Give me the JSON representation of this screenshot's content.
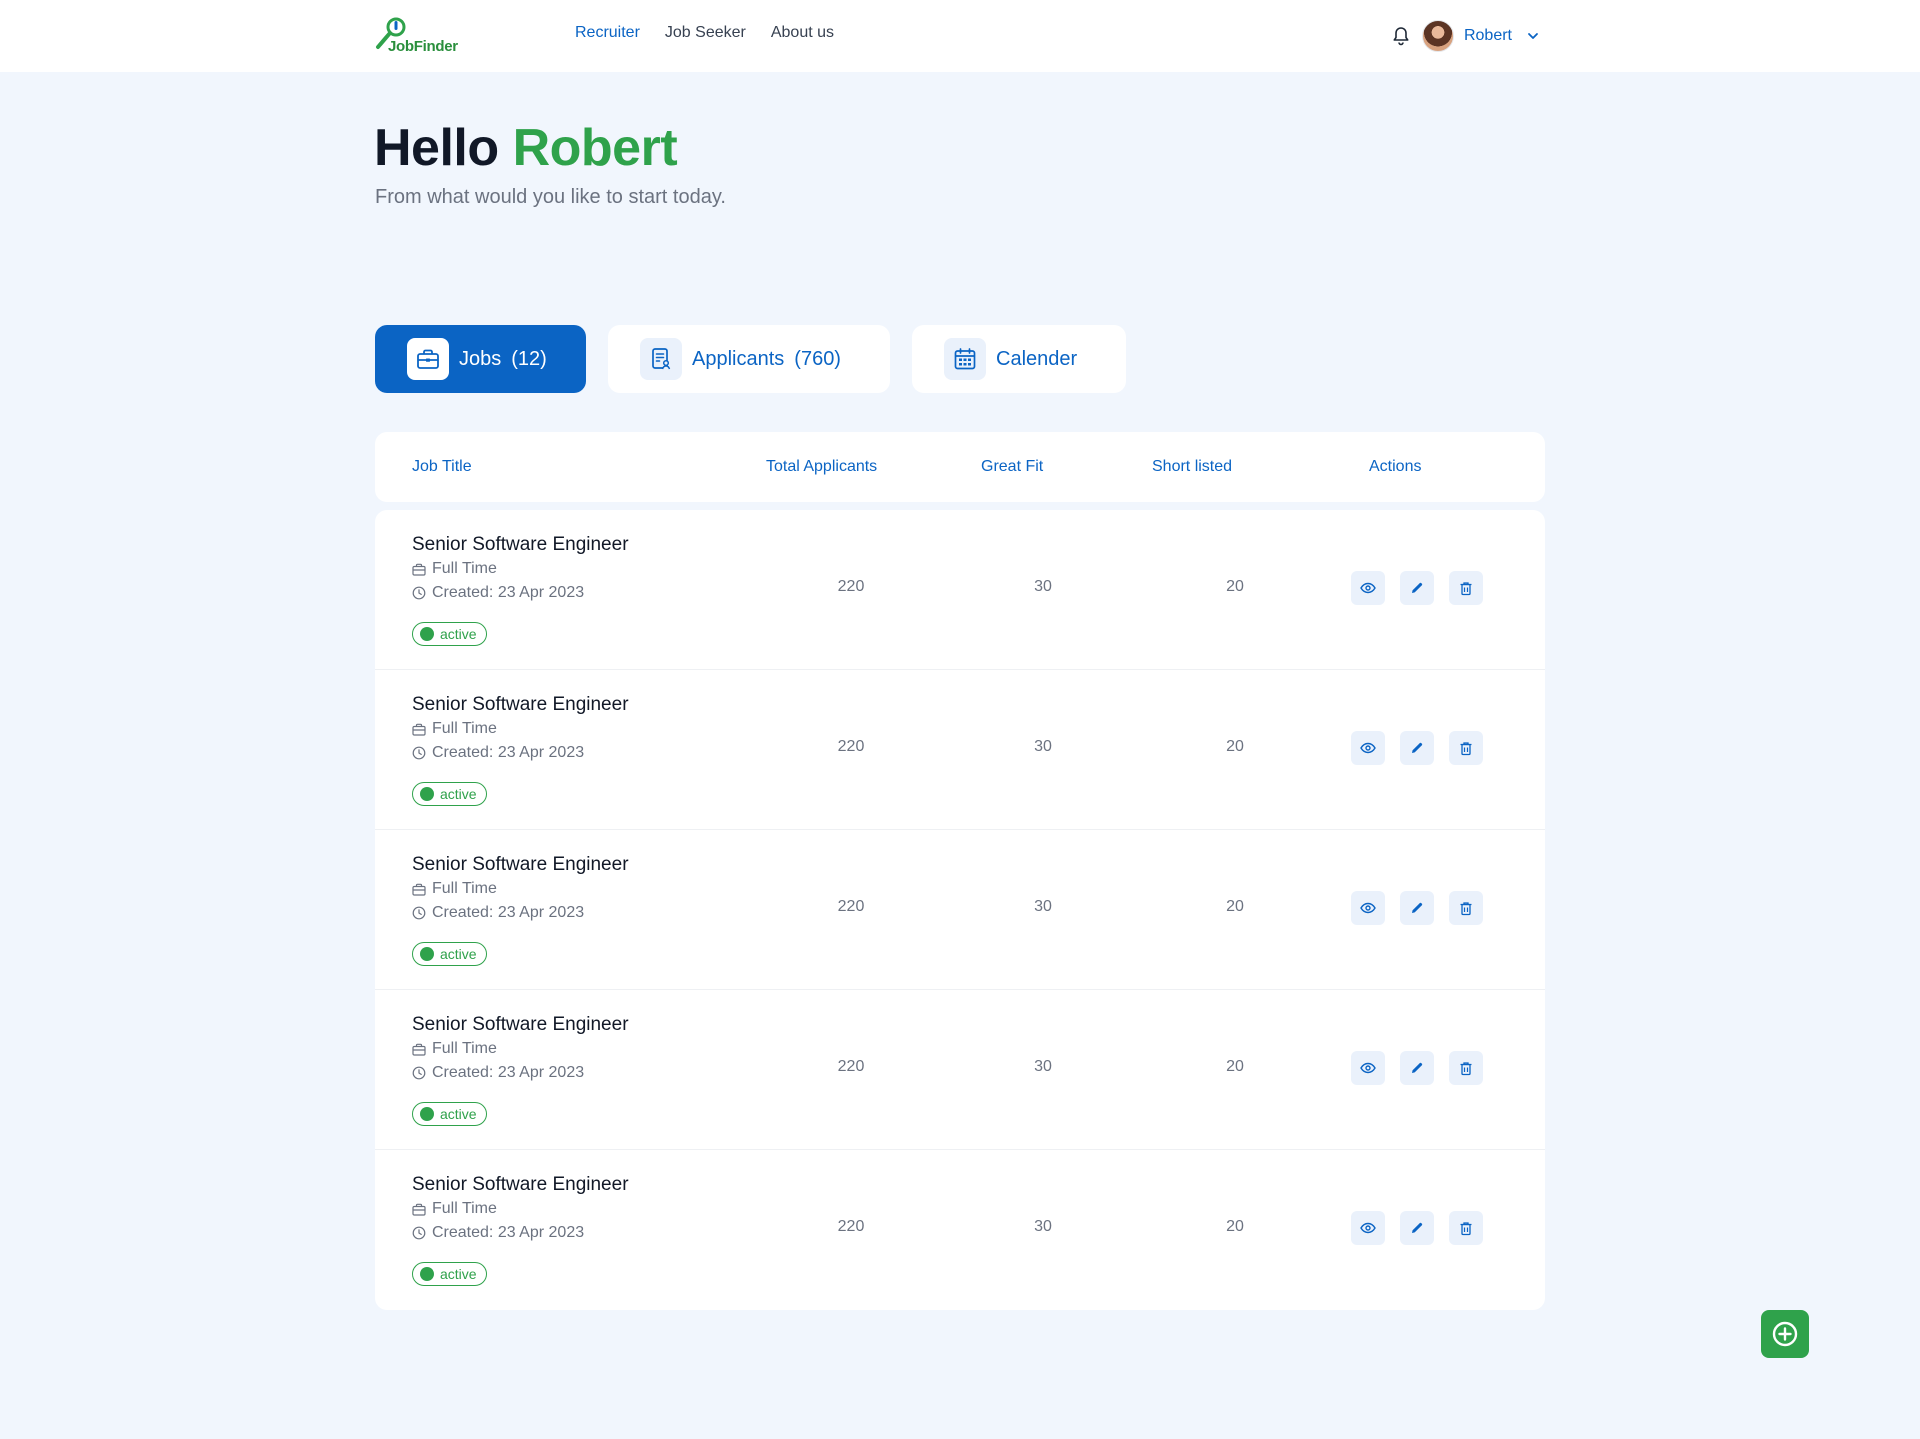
{
  "header": {
    "logo_text": "JobFinder",
    "nav": [
      {
        "label": "Recruiter",
        "active": true
      },
      {
        "label": "Job Seeker",
        "active": false
      },
      {
        "label": "About us",
        "active": false
      }
    ],
    "user_name": "Robert"
  },
  "greeting": {
    "hello": "Hello",
    "name": "Robert",
    "subtitle": "From what would you like to start today."
  },
  "tabs": [
    {
      "label": "Jobs",
      "count": "(12)",
      "icon": "briefcase-icon",
      "active": true
    },
    {
      "label": "Applicants",
      "count": "(760)",
      "icon": "applicant-document-icon",
      "active": false
    },
    {
      "label": "Calender",
      "count": "",
      "icon": "calendar-icon",
      "active": false
    }
  ],
  "table": {
    "columns": [
      "Job Title",
      "Total Applicants",
      "Great Fit",
      "Short listed",
      "Actions"
    ],
    "rows": [
      {
        "title": "Senior Software Engineer",
        "type": "Full Time",
        "created": "Created: 23 Apr 2023",
        "status": "active",
        "total": "220",
        "great_fit": "30",
        "short_listed": "20"
      },
      {
        "title": "Senior Software Engineer",
        "type": "Full Time",
        "created": "Created: 23 Apr 2023",
        "status": "active",
        "total": "220",
        "great_fit": "30",
        "short_listed": "20"
      },
      {
        "title": "Senior Software Engineer",
        "type": "Full Time",
        "created": "Created: 23 Apr 2023",
        "status": "active",
        "total": "220",
        "great_fit": "30",
        "short_listed": "20"
      },
      {
        "title": "Senior Software Engineer",
        "type": "Full Time",
        "created": "Created: 23 Apr 2023",
        "status": "active",
        "total": "220",
        "great_fit": "30",
        "short_listed": "20"
      },
      {
        "title": "Senior Software Engineer",
        "type": "Full Time",
        "created": "Created: 23 Apr 2023",
        "status": "active",
        "total": "220",
        "great_fit": "30",
        "short_listed": "20"
      }
    ]
  },
  "colors": {
    "primary": "#0b64c4",
    "accent_green": "#2fa24b",
    "background": "#f1f6fd"
  }
}
